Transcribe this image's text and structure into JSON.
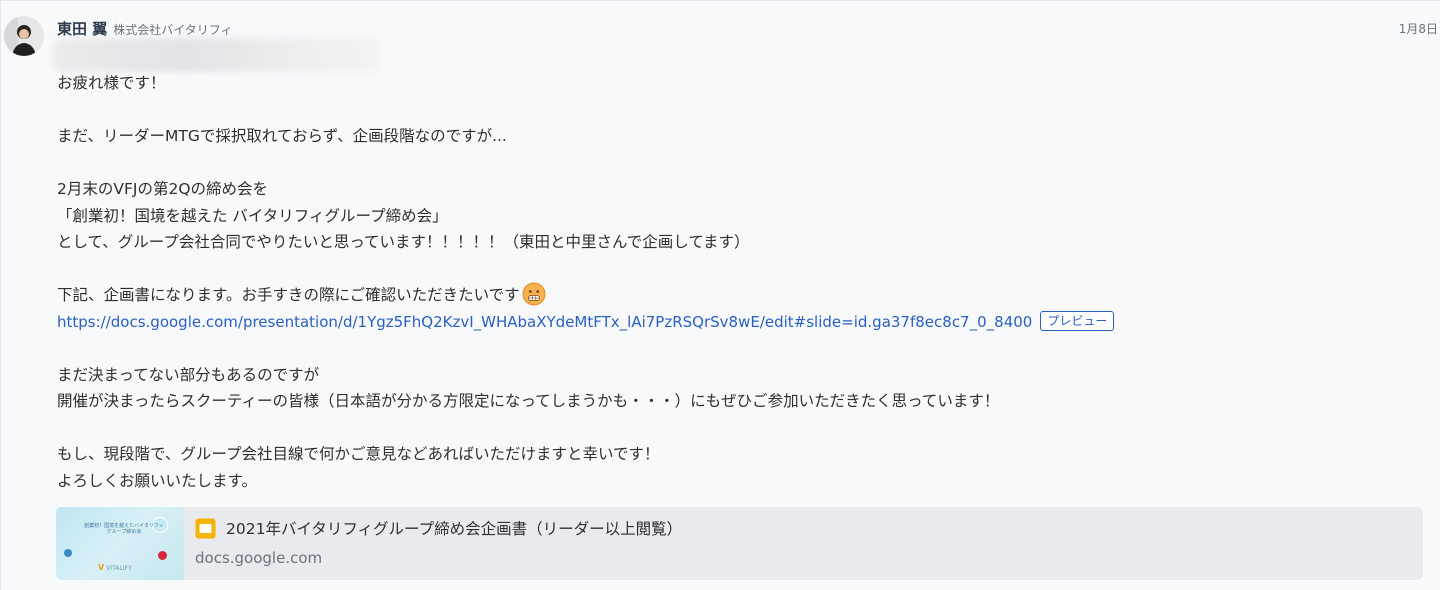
{
  "header": {
    "sender_name": "東田 翼",
    "sender_company": "株式会社バイタリフィ",
    "timestamp": "1月8日"
  },
  "message": {
    "lines": [
      "お疲れ様です！",
      "",
      "まだ、リーダーMTGで採択取れておらず、企画段階なのですが...",
      "",
      "2月末のVFJの第2Qの締め会を",
      "「創業初！国境を越えた バイタリフィグループ締め会」",
      "として、グループ会社合同でやりたいと思っています！！！！！（東田と中里さんで企画してます）",
      "",
      "下記、企画書になります。お手すきの際にご確認いただきたいです"
    ],
    "link": "https://docs.google.com/presentation/d/1Ygz5FhQ2KzvI_WHAbaXYdeMtFTx_lAi7PzRSQrSv8wE/edit#slide=id.ga37f8ec8c7_0_8400",
    "preview_label": "プレビュー",
    "lines_after_link": [
      "",
      "まだ決まってない部分もあるのですが",
      "開催が決まったらスクーティーの皆様（日本語が分かる方限定になってしまうかも・・・）にもぜひご参加いただきたく思っています！",
      "",
      "もし、現段階で、グループ会社目線で何かご意見などあればいただけますと幸いです！",
      "よろしくお願いいたします。"
    ]
  },
  "attachment": {
    "title": "2021年バイタリフィグループ締め会企画書（リーダー以上閲覧）",
    "domain": "docs.google.com",
    "icon": "google-slides-icon",
    "thumbnail": {
      "title_text": "創業初！国境を越えたバイタリフィグループ締め会",
      "brand": "VITALIFY"
    }
  },
  "colors": {
    "link": "#2a60c4",
    "name": "#2b3a4d",
    "slides_icon": "#f4b400",
    "attachment_bg": "#e9eaed"
  }
}
